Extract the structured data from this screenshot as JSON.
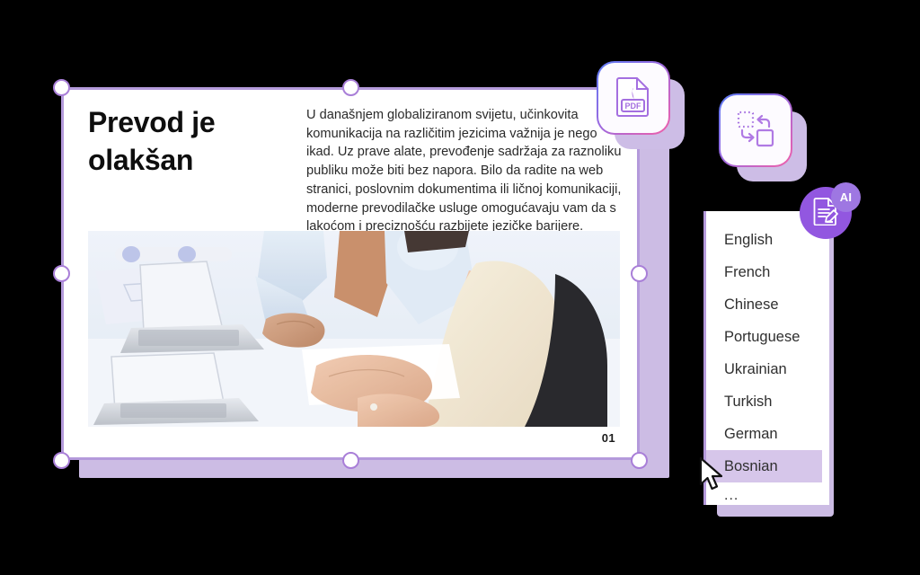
{
  "slide": {
    "heading": "Prevod je olakšan",
    "paragraph": "U današnjem globaliziranom svijetu, učinkovita komunikacija na različitim jezicima važnija je nego ikad. Uz prave alate, prevođenje sadržaja za raznoliku publiku može biti bez napora. Bilo da radite na web stranici, poslovnim dokumentima ili ličnoj komunikaciji, moderne prevodilačke usluge omogućavaju vam da s lakoćom i preciznošću razbijete jezičke barijere.",
    "page_number": "01",
    "photo_alt": "people-working-on-laptops-photo"
  },
  "floating_tools": [
    {
      "name": "pdf-file-icon",
      "label": "PDF"
    },
    {
      "name": "convert-format-icon",
      "label": ""
    }
  ],
  "ai_bubble": {
    "icon": "document-edit-icon",
    "badge": "AI"
  },
  "language_dropdown": {
    "items": [
      {
        "label": "English",
        "selected": false
      },
      {
        "label": "French",
        "selected": false
      },
      {
        "label": "Chinese",
        "selected": false
      },
      {
        "label": "Portuguese",
        "selected": false
      },
      {
        "label": "Ukrainian",
        "selected": false
      },
      {
        "label": "Turkish",
        "selected": false
      },
      {
        "label": "German",
        "selected": false
      },
      {
        "label": "Bosnian",
        "selected": true
      }
    ],
    "more": "..."
  },
  "colors": {
    "accent_purple": "#9257e0",
    "frame_border": "#b49adb",
    "backdrop_purple": "#ccbce4",
    "highlight_row": "#d6c6ea",
    "gradient_start": "#5b7cf5",
    "gradient_mid": "#9a6ae0",
    "gradient_end": "#f25fa8"
  },
  "cursor": {
    "name": "mouse-pointer"
  }
}
